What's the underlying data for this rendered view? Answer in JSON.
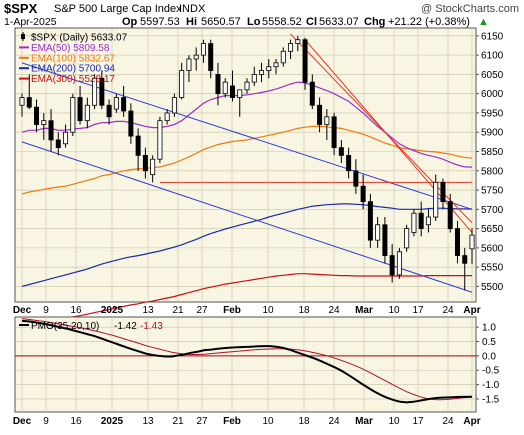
{
  "colors": {
    "panel_bg": "#f8f5e3",
    "panel_border": "#555555",
    "grid": "#c9c3a8",
    "up_candle": "#ffffff",
    "down_candle": "#000000",
    "candle_outline": "#000000",
    "ema50": "#9b30c8",
    "ema100": "#ee7a10",
    "ema200": "#1a2ab0",
    "ema300": "#cc1010",
    "channel": "#2a3cd8",
    "trend_red": "#ee3020",
    "pmo": "#000000",
    "pmo_signal": "#b01030",
    "zero_line": "#aa0000"
  },
  "header": {
    "symbol": "$SPX",
    "name": "S&P 500 Large Cap Index",
    "exchange": "INDX",
    "watermark": "@ StockCharts.com",
    "date": "1-Apr-2025",
    "open_label": "Op",
    "open": "5597.53",
    "high_label": "Hi",
    "high": "5650.57",
    "low_label": "Lo",
    "low": "5558.52",
    "close_label": "Cl",
    "close": "5633.07",
    "change_label": "Chg",
    "change": "+21.22 (+0.38%)",
    "change_arrow": "▲"
  },
  "legend": [
    {
      "label": "$SPX (Daily) 5633.07",
      "color": "#000000",
      "marker": "candle"
    },
    {
      "label": "EMA(50) 5809.58",
      "color": "#9b30c8",
      "marker": "line"
    },
    {
      "label": "EMA(100) 5832.67",
      "color": "#ee7a10",
      "marker": "line"
    },
    {
      "label": "EMA(200) 5700.94",
      "color": "#1a2ab0",
      "marker": "line"
    },
    {
      "label": "EMA(300) 5528.17",
      "color": "#cc1010",
      "marker": "line"
    }
  ],
  "pmo_legend": {
    "label": "PMO(35,20,10)",
    "value1": "-1.42",
    "value2": "-1.43"
  },
  "x_ticks": [
    "Dec",
    "9",
    "16",
    "2025",
    "13",
    "21",
    "27",
    "Feb",
    "10",
    "18",
    "24",
    "Mar",
    "10",
    "17",
    "24",
    "Apr"
  ],
  "chart_data": [
    {
      "type": "candlestick",
      "title": "$SPX S&P 500 Large Cap Index",
      "ylim": [
        5470,
        6160
      ],
      "y_ticks": [
        5500,
        5550,
        5600,
        5650,
        5700,
        5750,
        5800,
        5850,
        5900,
        5950,
        6000,
        6050,
        6100,
        6150
      ],
      "candles": [
        [
          5970,
          6000,
          5940,
          5990
        ],
        [
          5990,
          6050,
          5960,
          5965
        ],
        [
          5965,
          5985,
          5900,
          5920
        ],
        [
          5920,
          5950,
          5880,
          5930
        ],
        [
          5930,
          5960,
          5850,
          5880
        ],
        [
          5880,
          5900,
          5840,
          5860
        ],
        [
          5870,
          5920,
          5860,
          5900
        ],
        [
          5900,
          6000,
          5890,
          5990
        ],
        [
          5990,
          6020,
          5920,
          5930
        ],
        [
          5930,
          5990,
          5910,
          5970
        ],
        [
          5970,
          6050,
          5960,
          6040
        ],
        [
          6040,
          6060,
          5960,
          5970
        ],
        [
          5970,
          5985,
          5920,
          5940
        ],
        [
          5960,
          6000,
          5950,
          5990
        ],
        [
          5990,
          6020,
          5940,
          5955
        ],
        [
          5955,
          5975,
          5870,
          5890
        ],
        [
          5890,
          5910,
          5800,
          5840
        ],
        [
          5840,
          5860,
          5780,
          5800
        ],
        [
          5790,
          5840,
          5770,
          5830
        ],
        [
          5830,
          5940,
          5820,
          5930
        ],
        [
          5930,
          5960,
          5920,
          5950
        ],
        [
          5950,
          6000,
          5940,
          5990
        ],
        [
          5990,
          6080,
          5985,
          6060
        ],
        [
          6060,
          6100,
          6030,
          6090
        ],
        [
          6090,
          6120,
          6060,
          6100
        ],
        [
          6100,
          6140,
          6080,
          6130
        ],
        [
          6130,
          6140,
          6040,
          6060
        ],
        [
          6050,
          6080,
          5970,
          6000
        ],
        [
          6000,
          6040,
          5990,
          6030
        ],
        [
          6020,
          6060,
          5980,
          5990
        ],
        [
          5990,
          6010,
          5940,
          6010
        ],
        [
          6010,
          6040,
          6000,
          6030
        ],
        [
          6030,
          6070,
          6020,
          6050
        ],
        [
          6050,
          6080,
          6030,
          6060
        ],
        [
          6060,
          6090,
          6040,
          6070
        ],
        [
          6070,
          6090,
          6050,
          6080
        ],
        [
          6080,
          6120,
          6070,
          6110
        ],
        [
          6110,
          6140,
          6090,
          6130
        ],
        [
          6130,
          6150,
          6110,
          6140
        ],
        [
          6140,
          6145,
          6010,
          6030
        ],
        [
          6030,
          6050,
          5960,
          5970
        ],
        [
          5970,
          5990,
          5900,
          5920
        ],
        [
          5920,
          5960,
          5880,
          5940
        ],
        [
          5940,
          5950,
          5840,
          5860
        ],
        [
          5860,
          5880,
          5820,
          5840
        ],
        [
          5840,
          5860,
          5780,
          5800
        ],
        [
          5800,
          5830,
          5740,
          5760
        ],
        [
          5760,
          5790,
          5700,
          5720
        ],
        [
          5720,
          5740,
          5600,
          5620
        ],
        [
          5620,
          5680,
          5600,
          5660
        ],
        [
          5660,
          5680,
          5560,
          5580
        ],
        [
          5580,
          5610,
          5510,
          5530
        ],
        [
          5530,
          5600,
          5520,
          5590
        ],
        [
          5600,
          5660,
          5590,
          5650
        ],
        [
          5640,
          5700,
          5630,
          5690
        ],
        [
          5690,
          5720,
          5630,
          5650
        ],
        [
          5660,
          5700,
          5640,
          5680
        ],
        [
          5680,
          5790,
          5670,
          5770
        ],
        [
          5770,
          5780,
          5700,
          5720
        ],
        [
          5720,
          5740,
          5640,
          5650
        ],
        [
          5650,
          5670,
          5560,
          5580
        ],
        [
          5580,
          5600,
          5490,
          5560
        ],
        [
          5597.53,
          5650.57,
          5558.52,
          5633.07
        ]
      ],
      "ema50": [
        5900,
        5905,
        5905,
        5910,
        5910,
        5905,
        5905,
        5908,
        5910,
        5912,
        5920,
        5925,
        5925,
        5928,
        5928,
        5925,
        5920,
        5915,
        5912,
        5912,
        5915,
        5920,
        5930,
        5945,
        5960,
        5975,
        5985,
        5990,
        5995,
        5995,
        5995,
        5997,
        6000,
        6003,
        6007,
        6012,
        6018,
        6025,
        6030,
        6028,
        6022,
        6015,
        6008,
        6000,
        5990,
        5980,
        5965,
        5950,
        5932,
        5915,
        5900,
        5885,
        5870,
        5860,
        5852,
        5845,
        5840,
        5836,
        5830,
        5822,
        5815,
        5810,
        5809.58
      ],
      "ema100": [
        5740,
        5745,
        5748,
        5752,
        5755,
        5758,
        5760,
        5765,
        5770,
        5775,
        5780,
        5787,
        5790,
        5795,
        5800,
        5803,
        5805,
        5806,
        5808,
        5810,
        5815,
        5820,
        5828,
        5836,
        5845,
        5855,
        5862,
        5868,
        5872,
        5876,
        5878,
        5880,
        5884,
        5888,
        5892,
        5896,
        5900,
        5905,
        5910,
        5913,
        5915,
        5915,
        5914,
        5912,
        5910,
        5905,
        5900,
        5895,
        5888,
        5880,
        5872,
        5866,
        5860,
        5857,
        5855,
        5852,
        5850,
        5849,
        5846,
        5843,
        5838,
        5835,
        5832.67
      ],
      "ema200": [
        5500,
        5505,
        5510,
        5515,
        5520,
        5525,
        5530,
        5535,
        5540,
        5545,
        5552,
        5558,
        5563,
        5568,
        5573,
        5577,
        5580,
        5584,
        5588,
        5592,
        5597,
        5602,
        5608,
        5615,
        5622,
        5630,
        5637,
        5643,
        5649,
        5654,
        5659,
        5664,
        5669,
        5674,
        5680,
        5685,
        5690,
        5695,
        5700,
        5704,
        5708,
        5710,
        5712,
        5713,
        5714,
        5714,
        5713,
        5712,
        5710,
        5707,
        5705,
        5703,
        5700,
        5700,
        5700,
        5700,
        5702,
        5703,
        5703,
        5702,
        5701,
        5701,
        5700.94
      ],
      "ema300": [
        5400,
        5403,
        5406,
        5409,
        5412,
        5415,
        5418,
        5421,
        5424,
        5428,
        5432,
        5436,
        5440,
        5444,
        5448,
        5452,
        5455,
        5459,
        5462,
        5466,
        5470,
        5474,
        5479,
        5484,
        5489,
        5494,
        5498,
        5502,
        5506,
        5509,
        5512,
        5515,
        5518,
        5521,
        5524,
        5527,
        5529,
        5531,
        5533,
        5533,
        5532,
        5531,
        5530,
        5529,
        5528,
        5528,
        5527,
        5527,
        5527,
        5527,
        5527,
        5527,
        5527,
        5527,
        5527,
        5527,
        5528,
        5528,
        5528,
        5528,
        5528,
        5528,
        5528.17
      ],
      "annotations": {
        "channel_upper": [
          [
            0,
            6080
          ],
          [
            62,
            5700
          ]
        ],
        "channel_lower": [
          [
            0,
            5875
          ],
          [
            62,
            5485
          ]
        ],
        "horizontal_resistance": [
          [
            19,
            5770
          ],
          [
            62,
            5770
          ]
        ],
        "red_trend_1": [
          [
            37,
            6155
          ],
          [
            62,
            5665
          ]
        ],
        "red_trend_2": [
          [
            39,
            6140
          ],
          [
            62,
            5640
          ]
        ]
      }
    },
    {
      "type": "line",
      "title": "PMO(35,20,10)",
      "ylim": [
        -1.85,
        1.25
      ],
      "y_ticks": [
        1.0,
        0.5,
        0.0,
        -0.5,
        -1.0,
        -1.5
      ],
      "series": [
        {
          "name": "PMO(35,20,10)",
          "values": [
            1.22,
            1.2,
            1.17,
            1.13,
            1.09,
            1.04,
            0.99,
            0.94,
            0.88,
            0.82,
            0.76,
            0.7,
            0.62,
            0.54,
            0.46,
            0.38,
            0.3,
            0.22,
            0.15,
            0.08,
            0.03,
            0.0,
            -0.02,
            -0.02,
            0.02,
            0.06,
            0.11,
            0.15,
            0.2,
            0.22,
            0.25,
            0.27,
            0.29,
            0.3,
            0.31,
            0.32,
            0.33,
            0.34,
            0.34,
            0.32,
            0.28,
            0.22,
            0.14,
            0.06,
            -0.02,
            -0.1,
            -0.2,
            -0.3,
            -0.4,
            -0.52,
            -0.66,
            -0.8,
            -0.96,
            -1.1,
            -1.24,
            -1.36,
            -1.46,
            -1.54,
            -1.6,
            -1.62,
            -1.6,
            -1.56,
            -1.52,
            -1.48,
            -1.46,
            -1.45,
            -1.44,
            -1.43,
            -1.43,
            -1.42
          ]
        },
        {
          "name": "",
          "values": [
            1.3,
            1.27,
            1.24,
            1.21,
            1.18,
            1.14,
            1.1,
            1.06,
            1.02,
            0.98,
            0.93,
            0.88,
            0.83,
            0.77,
            0.71,
            0.64,
            0.57,
            0.5,
            0.43,
            0.36,
            0.3,
            0.24,
            0.18,
            0.13,
            0.09,
            0.06,
            0.05,
            0.05,
            0.06,
            0.08,
            0.1,
            0.12,
            0.14,
            0.16,
            0.18,
            0.2,
            0.22,
            0.23,
            0.24,
            0.25,
            0.25,
            0.24,
            0.22,
            0.19,
            0.15,
            0.1,
            0.05,
            -0.01,
            -0.08,
            -0.16,
            -0.24,
            -0.33,
            -0.43,
            -0.54,
            -0.66,
            -0.78,
            -0.9,
            -1.02,
            -1.14,
            -1.25,
            -1.34,
            -1.42,
            -1.48,
            -1.52,
            -1.53,
            -1.52,
            -1.5,
            -1.47,
            -1.45,
            -1.43
          ]
        }
      ]
    }
  ]
}
